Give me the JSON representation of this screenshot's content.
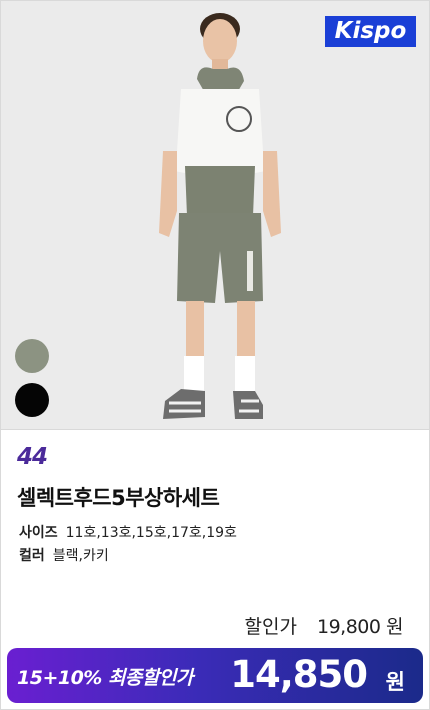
{
  "brand": {
    "logo_text": "Kispo",
    "color": "#1a3fd6"
  },
  "product": {
    "image_description_icon": "product-photo",
    "color_swatches": [
      {
        "name": "khaki-swatch",
        "color": "#8c9382"
      },
      {
        "name": "black-swatch",
        "color": "#050505"
      }
    ],
    "code": "44",
    "title": "셀렉트후드5부상하세트",
    "size_label": "사이즈",
    "size_value": "11호,13호,15호,17호,19호",
    "color_label": "컬러",
    "color_value": "블랙,카키"
  },
  "pricing": {
    "discount_label": "할인가",
    "discount_value": "19,800 원",
    "final_label": "15+10% 최종할인가",
    "final_amount": "14,850",
    "final_unit": "원",
    "accent_start": "#6a1fd1",
    "accent_end": "#1b2a8a"
  }
}
